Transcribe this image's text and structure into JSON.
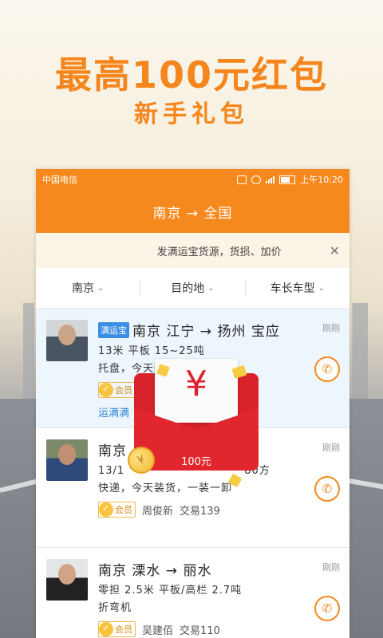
{
  "promo": {
    "title": "最高100元红包",
    "subtitle": "新手礼包"
  },
  "statusbar": {
    "carrier": "中国电信",
    "time": "上午10:20"
  },
  "navbar": {
    "title": "南京 → 全国"
  },
  "notice": {
    "text": "发满运宝货源，货损、加价",
    "close": "✕"
  },
  "filters": [
    {
      "label": "南京"
    },
    {
      "label": "目的地"
    },
    {
      "label": "车长车型"
    }
  ],
  "listings": [
    {
      "badge": "满运宝",
      "route": "南京 江宁 → 扬州 宝应",
      "time": "刚刚",
      "line1": "13米 平板 15~25吨",
      "line2": "托盘，今天装货",
      "member": "会员",
      "link": "运满满"
    },
    {
      "route": "南京",
      "time": "刚刚",
      "line1": "13/1",
      "line1_tail": "80方",
      "line2": "快递，今天装货，一装一卸",
      "member": "会员",
      "contact": "周俊新",
      "trades": "交易139"
    },
    {
      "route": "南京 溧水 → 丽水",
      "time": "刚刚",
      "line1": "零担 2.5米 平板/高栏 2.7吨",
      "line2": "折弯机",
      "member": "会员",
      "contact": "吴建佰",
      "trades": "交易110"
    }
  ],
  "packet": {
    "symbol": "¥",
    "amount": "100元",
    "coin_symbol": "¥"
  },
  "colors": {
    "brand_orange": "#f6891e",
    "packet_red": "#e2262e",
    "link_blue": "#2d86d8"
  }
}
